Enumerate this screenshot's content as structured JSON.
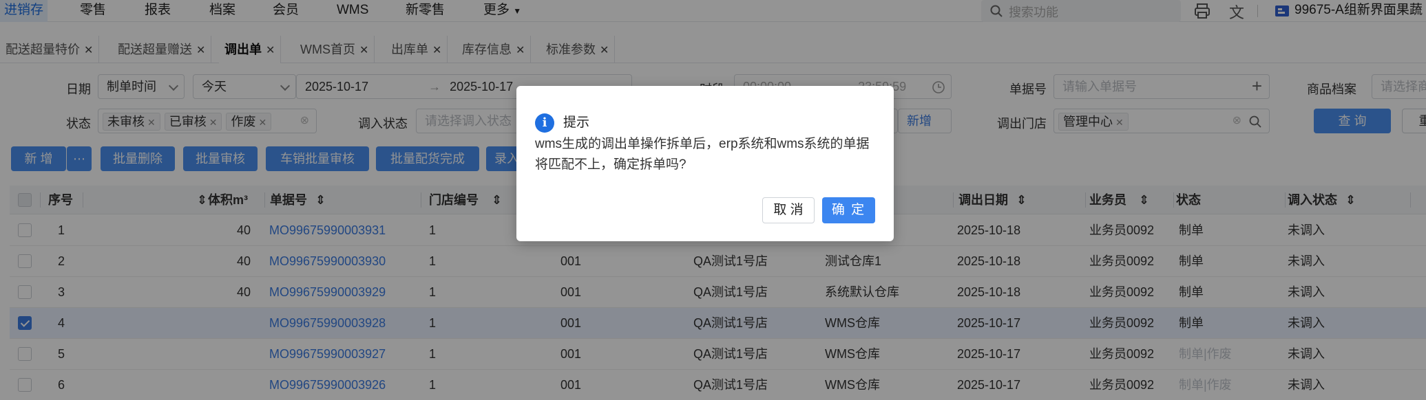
{
  "nav": {
    "items": [
      "进销存",
      "零售",
      "报表",
      "档案",
      "会员",
      "WMS",
      "新零售",
      "更多"
    ],
    "active_index": 0,
    "search_placeholder": "搜索功能",
    "account": "99675-A组新界面果蔬"
  },
  "tabs": [
    "配送超量特价",
    "配送超量赠送",
    "调出单",
    "WMS首页",
    "出库单",
    "库存信息",
    "标准参数"
  ],
  "active_tab_index": 2,
  "filters": {
    "date_label": "日期",
    "date_type": "制单时间",
    "date_range": "今天",
    "date_start": "2025-10-17",
    "date_arrow": "→",
    "date_end": "2025-10-17",
    "time_label": "时段",
    "time_start": "00:00:00",
    "time_end": "23:59:59",
    "doc_no_label": "单据号",
    "doc_no_placeholder": "请输入单据号",
    "goods_label": "商品档案",
    "goods_placeholder": "请选择商",
    "status_label": "状态",
    "status_chips": [
      "未审核",
      "已审核",
      "作废"
    ],
    "in_status_label": "调入状态",
    "in_status_placeholder": "请选择调入状态",
    "add_link": "新增",
    "out_store_label": "调出门店",
    "out_store_chip": "管理中心",
    "query_button": "查 询",
    "reset_button": "重 置"
  },
  "actions": [
    "新 增",
    "批量删除",
    "批量审核",
    "车销批量审核",
    "批量配货完成",
    "录入"
  ],
  "table": {
    "headers": {
      "seq": "序号",
      "volume": "体积m³",
      "doc_no": "单据号",
      "store_no": "门店编号",
      "out_date": "调出日期",
      "salesman": "业务员",
      "status": "状态",
      "in_status": "调入状态"
    },
    "rows": [
      {
        "seq": "1",
        "volume": "40",
        "doc_no": "MO99675990003931",
        "store_no": "1",
        "code": "",
        "store": "",
        "warehouse": "",
        "out_date": "2025-10-18",
        "salesman": "业务员0092",
        "status": "制单",
        "in_status": "未调入",
        "checked": false
      },
      {
        "seq": "2",
        "volume": "40",
        "doc_no": "MO99675990003930",
        "store_no": "1",
        "code": "001",
        "store": "QA测试1号店",
        "warehouse": "测试仓库1",
        "out_date": "2025-10-18",
        "salesman": "业务员0092",
        "status": "制单",
        "in_status": "未调入",
        "checked": false
      },
      {
        "seq": "3",
        "volume": "40",
        "doc_no": "MO99675990003929",
        "store_no": "1",
        "code": "001",
        "store": "QA测试1号店",
        "warehouse": "系统默认仓库",
        "out_date": "2025-10-18",
        "salesman": "业务员0092",
        "status": "制单",
        "in_status": "未调入",
        "checked": false
      },
      {
        "seq": "4",
        "volume": "",
        "doc_no": "MO99675990003928",
        "store_no": "1",
        "code": "001",
        "store": "QA测试1号店",
        "warehouse": "WMS仓库",
        "out_date": "2025-10-17",
        "salesman": "业务员0092",
        "status": "制单",
        "in_status": "未调入",
        "checked": true
      },
      {
        "seq": "5",
        "volume": "",
        "doc_no": "MO99675990003927",
        "store_no": "1",
        "code": "001",
        "store": "QA测试1号店",
        "warehouse": "WMS仓库",
        "out_date": "2025-10-17",
        "salesman": "业务员0092",
        "status": "制单|作废",
        "in_status": "未调入",
        "checked": false
      },
      {
        "seq": "6",
        "volume": "",
        "doc_no": "MO99675990003926",
        "store_no": "1",
        "code": "001",
        "store": "QA测试1号店",
        "warehouse": "WMS仓库",
        "out_date": "2025-10-17",
        "salesman": "业务员0092",
        "status": "制单|作废",
        "in_status": "未调入",
        "checked": false
      }
    ]
  },
  "dialog": {
    "title": "提示",
    "message": "wms生成的调出单操作拆单后，erp系统和wms系统的单据将匹配不上，确定拆单吗?",
    "cancel": "取 消",
    "confirm": "确 定"
  },
  "colors": {
    "primary": "#3c86f0",
    "link": "#3c7be0",
    "overlay": "rgba(0,0,0,0.42)"
  }
}
